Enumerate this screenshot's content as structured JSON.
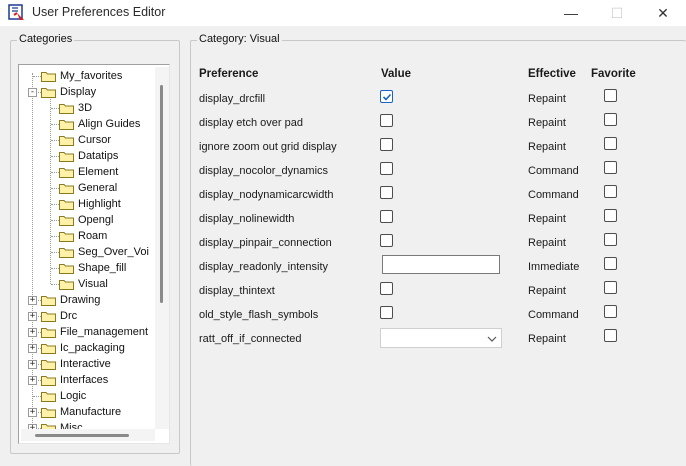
{
  "window": {
    "title": "User Preferences Editor",
    "minimize_glyph": "—",
    "maximize_glyph": "☐",
    "close_glyph": "✕"
  },
  "categories_panel": {
    "legend": "Categories"
  },
  "tree": {
    "items": [
      {
        "label": "My_favorites",
        "level": 1,
        "expander": ""
      },
      {
        "label": "Display",
        "level": 1,
        "expander": "-"
      },
      {
        "label": "3D",
        "level": 2,
        "expander": ""
      },
      {
        "label": "Align Guides",
        "level": 2,
        "expander": ""
      },
      {
        "label": "Cursor",
        "level": 2,
        "expander": ""
      },
      {
        "label": "Datatips",
        "level": 2,
        "expander": ""
      },
      {
        "label": "Element",
        "level": 2,
        "expander": ""
      },
      {
        "label": "General",
        "level": 2,
        "expander": ""
      },
      {
        "label": "Highlight",
        "level": 2,
        "expander": ""
      },
      {
        "label": "Opengl",
        "level": 2,
        "expander": ""
      },
      {
        "label": "Roam",
        "level": 2,
        "expander": ""
      },
      {
        "label": "Seg_Over_Voi",
        "level": 2,
        "expander": ""
      },
      {
        "label": "Shape_fill",
        "level": 2,
        "expander": ""
      },
      {
        "label": "Visual",
        "level": 2,
        "expander": ""
      },
      {
        "label": "Drawing",
        "level": 1,
        "expander": "+"
      },
      {
        "label": "Drc",
        "level": 1,
        "expander": "+"
      },
      {
        "label": "File_management",
        "level": 1,
        "expander": "+"
      },
      {
        "label": "Ic_packaging",
        "level": 1,
        "expander": "+"
      },
      {
        "label": "Interactive",
        "level": 1,
        "expander": "+"
      },
      {
        "label": "Interfaces",
        "level": 1,
        "expander": "+"
      },
      {
        "label": "Logic",
        "level": 1,
        "expander": ""
      },
      {
        "label": "Manufacture",
        "level": 1,
        "expander": "+"
      },
      {
        "label": "Misc",
        "level": 1,
        "expander": "+"
      }
    ]
  },
  "category_panel": {
    "legend": "Category:  Visual"
  },
  "columns": {
    "preference": "Preference",
    "value": "Value",
    "effective": "Effective",
    "favorite": "Favorite"
  },
  "preferences": [
    {
      "name": "display_drcfill",
      "value_type": "checkbox",
      "checked": true,
      "effective": "Repaint",
      "favorite": false
    },
    {
      "name": "display etch over pad",
      "value_type": "checkbox",
      "checked": false,
      "effective": "Repaint",
      "favorite": false
    },
    {
      "name": "ignore zoom out grid display",
      "value_type": "checkbox",
      "checked": false,
      "effective": "Repaint",
      "favorite": false
    },
    {
      "name": "display_nocolor_dynamics",
      "value_type": "checkbox",
      "checked": false,
      "effective": "Command",
      "favorite": false
    },
    {
      "name": "display_nodynamicarcwidth",
      "value_type": "checkbox",
      "checked": false,
      "effective": "Command",
      "favorite": false
    },
    {
      "name": "display_nolinewidth",
      "value_type": "checkbox",
      "checked": false,
      "effective": "Repaint",
      "favorite": false
    },
    {
      "name": "display_pinpair_connection",
      "value_type": "checkbox",
      "checked": false,
      "effective": "Repaint",
      "favorite": false
    },
    {
      "name": "display_readonly_intensity",
      "value_type": "text",
      "value": "",
      "effective": "Immediate",
      "favorite": false
    },
    {
      "name": "display_thintext",
      "value_type": "checkbox",
      "checked": false,
      "effective": "Repaint",
      "favorite": false
    },
    {
      "name": "old_style_flash_symbols",
      "value_type": "checkbox",
      "checked": false,
      "effective": "Command",
      "favorite": false
    },
    {
      "name": "ratt_off_if_connected",
      "value_type": "combo",
      "value": "",
      "effective": "Repaint",
      "favorite": false
    }
  ],
  "colors": {
    "window_bg": "#f0f0f0",
    "folder_fill": "#fff1a8",
    "folder_stroke": "#8a7a1e",
    "check_accent": "#1a63c4"
  }
}
